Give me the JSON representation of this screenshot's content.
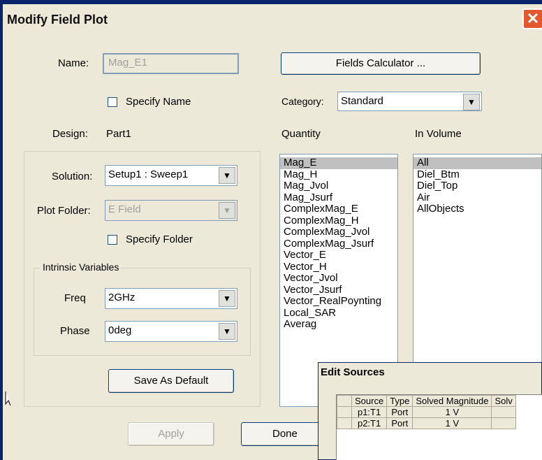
{
  "window": {
    "title": "Modify Field Plot",
    "close_glyph": "✕"
  },
  "name": {
    "label": "Name:",
    "value": "Mag_E1"
  },
  "fields_calculator": {
    "label": "Fields Calculator ..."
  },
  "specify_name": {
    "label": "Specify Name",
    "checked": false
  },
  "category": {
    "label": "Category:",
    "value": "Standard"
  },
  "design": {
    "label": "Design:",
    "value": "Part1"
  },
  "quantity": {
    "label": "Quantity",
    "items": [
      "Mag_E",
      "Mag_H",
      "Mag_Jvol",
      "Mag_Jsurf",
      "ComplexMag_E",
      "ComplexMag_H",
      "ComplexMag_Jvol",
      "ComplexMag_Jsurf",
      "Vector_E",
      "Vector_H",
      "Vector_Jvol",
      "Vector_Jsurf",
      "Vector_RealPoynting",
      "Local_SAR",
      "Averag"
    ],
    "selected": "Mag_E"
  },
  "in_volume": {
    "label": "In Volume",
    "items": [
      "All",
      "Diel_Btm",
      "Diel_Top",
      "Air",
      "AllObjects"
    ],
    "selected": "All"
  },
  "solution": {
    "label": "Solution:",
    "value": "Setup1 : Sweep1"
  },
  "plot_folder": {
    "label": "Plot Folder:",
    "value": "E Field"
  },
  "specify_folder": {
    "label": "Specify Folder",
    "checked": false
  },
  "intrinsic": {
    "legend": "Intrinsic Variables",
    "freq": {
      "label": "Freq",
      "value": "2GHz"
    },
    "phase": {
      "label": "Phase",
      "value": "0deg"
    }
  },
  "save_default": {
    "label": "Save As Default"
  },
  "apply": {
    "label": "Apply"
  },
  "done": {
    "label": "Done"
  },
  "edit_sources": {
    "title": "Edit Sources",
    "columns": [
      "Source",
      "Type",
      "Solved Magnitude",
      "Solv"
    ],
    "rows": [
      {
        "source": "p1:T1",
        "type": "Port",
        "magnitude": "1 V"
      },
      {
        "source": "p2:T1",
        "type": "Port",
        "magnitude": "1 V"
      }
    ]
  },
  "icons": {
    "dropdown": "chevron-down-icon",
    "close": "close-icon"
  }
}
